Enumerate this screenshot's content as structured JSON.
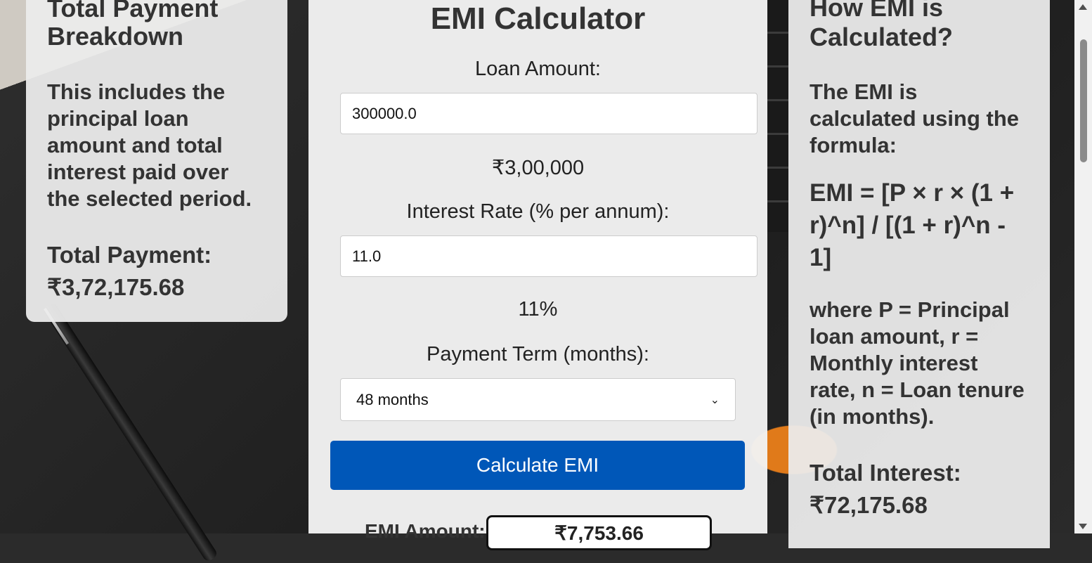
{
  "left_card": {
    "title": "Total Payment Breakdown",
    "description": "This includes the principal loan amount and total interest paid over the selected period.",
    "total_label": "Total Payment:",
    "total_value": "₹3,72,175.68"
  },
  "calculator": {
    "title": "EMI Calculator",
    "loan_amount_label": "Loan Amount:",
    "loan_amount_value": "300000.0",
    "loan_amount_display": "₹3,00,000",
    "interest_rate_label": "Interest Rate (% per annum):",
    "interest_rate_value": "11.0",
    "interest_rate_display": "11%",
    "term_label": "Payment Term (months):",
    "term_selected": "48 months",
    "calculate_button": "Calculate EMI",
    "emi_label": "EMI Amount:",
    "emi_value": "₹7,753.66"
  },
  "right_card": {
    "title": "How EMI is Calculated?",
    "description": "The EMI is calculated using the formula:",
    "formula": "EMI = [P × r × (1 + r)^n] / [(1 + r)^n - 1]",
    "where": "where P = Principal loan amount, r = Monthly interest rate, n = Loan tenure (in months).",
    "total_label": "Total Interest:",
    "total_value": "₹72,175.68"
  },
  "colors": {
    "primary_button": "#0057b8"
  }
}
